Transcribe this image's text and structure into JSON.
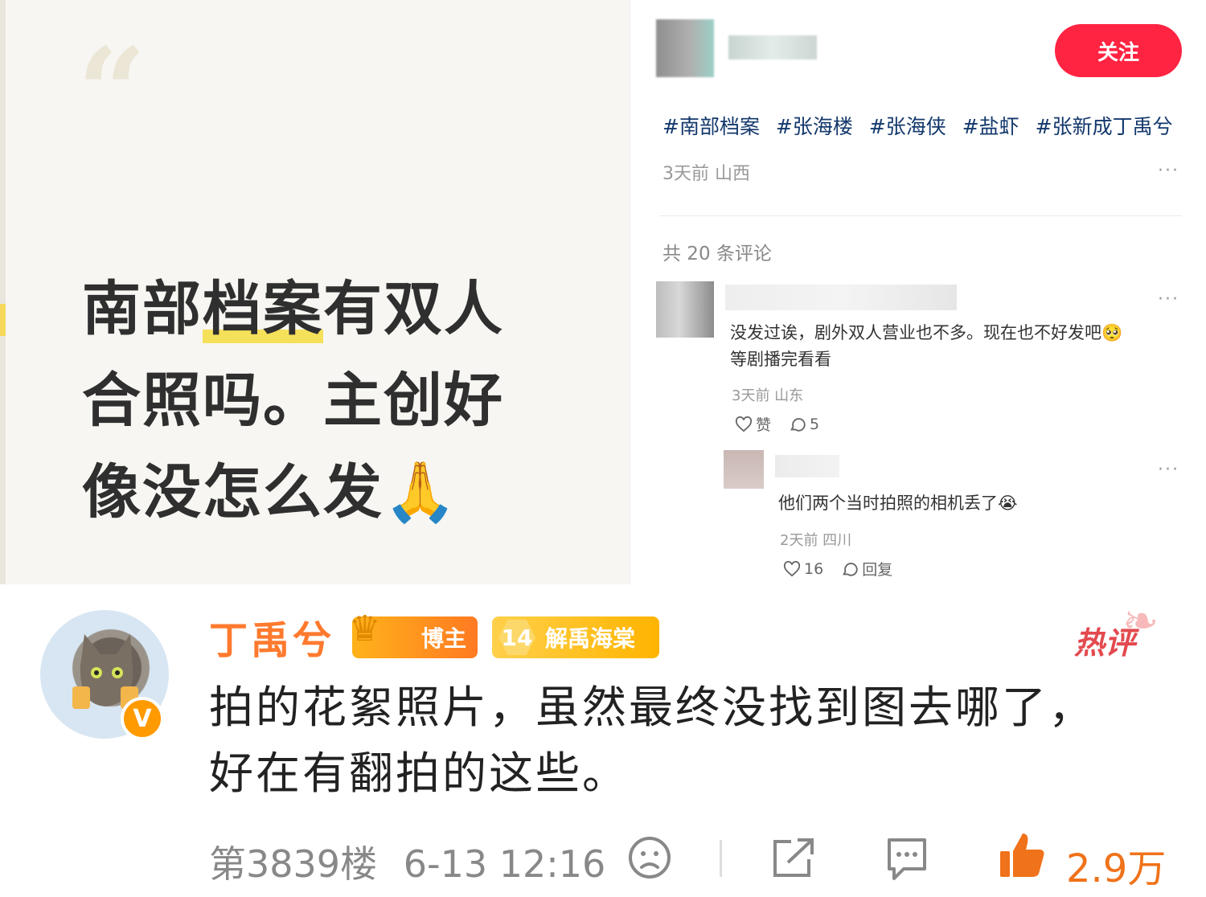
{
  "note_card": {
    "quote_mark": "“",
    "text_line1_a": "南部",
    "text_line1_hl": "档案",
    "text_line1_b": "有双人",
    "text_line2": "合照吗。主创好",
    "text_line3": "像没怎么发🙏"
  },
  "post": {
    "follow_label": "关注",
    "tags": [
      "#南部档案",
      "#张海楼",
      "#张海侠",
      "#盐虾",
      "#张新成丁禹兮"
    ],
    "meta": "3天前 山西",
    "more": "···",
    "comment_count": "共 20 条评论"
  },
  "comments": [
    {
      "text_line1": "没发过诶，剧外双人营业也不多。现在也不好发吧🥺",
      "text_line2": "等剧播完看看",
      "meta": "3天前 山东",
      "like_label": "赞",
      "reply_count": "5"
    },
    {
      "text": "他们两个当时拍照的相机丢了😭",
      "meta": "2天前 四川",
      "like_count": "16",
      "reply_label": "回复"
    }
  ],
  "weibo": {
    "username": "丁禹兮",
    "verified_badge": "V",
    "badge_blogger": "博主",
    "fan_level": "14",
    "fan_group": "解禹海棠",
    "hot_label": "热评",
    "text_line1": "拍的花絮照片，虽然最终没找到图去哪了，",
    "text_line2": "好在有翻拍的这些。",
    "floor": "第3839楼",
    "time": "6-13 12:16",
    "likes": "2.9万"
  },
  "colors": {
    "follow_button": "#ff2442",
    "tag_text": "#13386c",
    "username": "#ff7a2e",
    "like_accent": "#f0721a",
    "hot_label": "#e34a4f"
  },
  "icons": [
    "heart-icon",
    "comment-icon",
    "sad-face-icon",
    "share-icon",
    "chat-icon",
    "thumbs-up-icon"
  ]
}
